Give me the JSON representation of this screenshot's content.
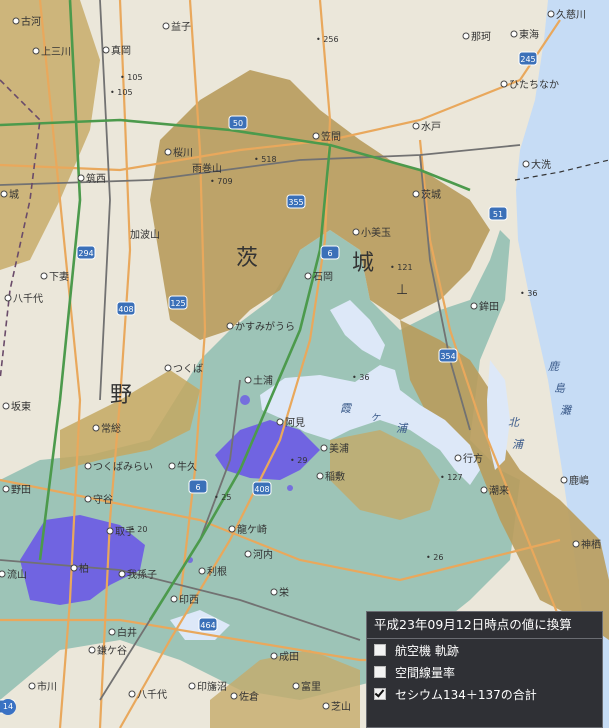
{
  "map": {
    "prefecture_label": [
      "茨",
      "城"
    ],
    "lake_labels": [
      "霞",
      "ヶ",
      "浦",
      "北",
      "浦"
    ],
    "coast_labels": [
      "鹿",
      "島",
      "灘"
    ],
    "area_labels": [
      "野",
      "筑波山",
      "加波山",
      "雨巻山"
    ],
    "places": [
      {
        "name": "益子"
      },
      {
        "name": "真岡"
      },
      {
        "name": "上三川"
      },
      {
        "name": "笠間"
      },
      {
        "name": "水戸"
      },
      {
        "name": "桜川"
      },
      {
        "name": "筑西"
      },
      {
        "name": "小美玉"
      },
      {
        "name": "石岡"
      },
      {
        "name": "鉾田"
      },
      {
        "name": "茨城"
      },
      {
        "name": "大洗"
      },
      {
        "name": "ひたちなか"
      },
      {
        "name": "那珂"
      },
      {
        "name": "東海"
      },
      {
        "name": "久慈川"
      },
      {
        "name": "かすみがうら"
      },
      {
        "name": "土浦"
      },
      {
        "name": "つくば"
      },
      {
        "name": "阿見"
      },
      {
        "name": "美浦"
      },
      {
        "name": "稲敷"
      },
      {
        "name": "牛久"
      },
      {
        "name": "常総"
      },
      {
        "name": "つくばみらい"
      },
      {
        "name": "守谷"
      },
      {
        "name": "野田"
      },
      {
        "name": "柏"
      },
      {
        "name": "我孫子"
      },
      {
        "name": "取手"
      },
      {
        "name": "龍ケ崎"
      },
      {
        "name": "河内"
      },
      {
        "name": "利根"
      },
      {
        "name": "印西"
      },
      {
        "name": "栄"
      },
      {
        "name": "白井"
      },
      {
        "name": "鎌ケ谷"
      },
      {
        "name": "成田"
      },
      {
        "name": "八千代"
      },
      {
        "name": "市川"
      },
      {
        "name": "流山"
      },
      {
        "name": "坂東"
      },
      {
        "name": "下妻"
      },
      {
        "name": "八千代"
      },
      {
        "name": "古河"
      },
      {
        "name": "城"
      },
      {
        "name": "行方"
      },
      {
        "name": "潮来"
      },
      {
        "name": "神栖"
      },
      {
        "name": "鹿嶋"
      },
      {
        "name": "印旛沼"
      },
      {
        "name": "佐倉"
      },
      {
        "name": "富里"
      },
      {
        "name": "芝山"
      }
    ],
    "elevations": [
      "518",
      "709",
      "256",
      "105",
      "127",
      "121",
      "29",
      "20",
      "26",
      "105",
      "25",
      "36",
      "36"
    ],
    "route_numbers": [
      "50",
      "355",
      "6",
      "125",
      "408",
      "294",
      "51",
      "354",
      "245",
      "6",
      "408",
      "464",
      "14"
    ],
    "colors": {
      "base_map": "#e9e4d6",
      "high_dose": "#b89a55",
      "medium_dose": "#86b6a6",
      "hot_spot": "#6a5ae0",
      "water": "#dbe7f7",
      "road": "#e8a85a",
      "rail": "#666666"
    }
  },
  "panel": {
    "title": "平成23年09月12日時点の値に換算",
    "options": [
      {
        "label": "航空機 軌跡",
        "checked": false
      },
      {
        "label": "空間線量率",
        "checked": false
      },
      {
        "label": "セシウム134＋137の合計",
        "checked": true
      }
    ]
  },
  "zoom_badge": "14"
}
